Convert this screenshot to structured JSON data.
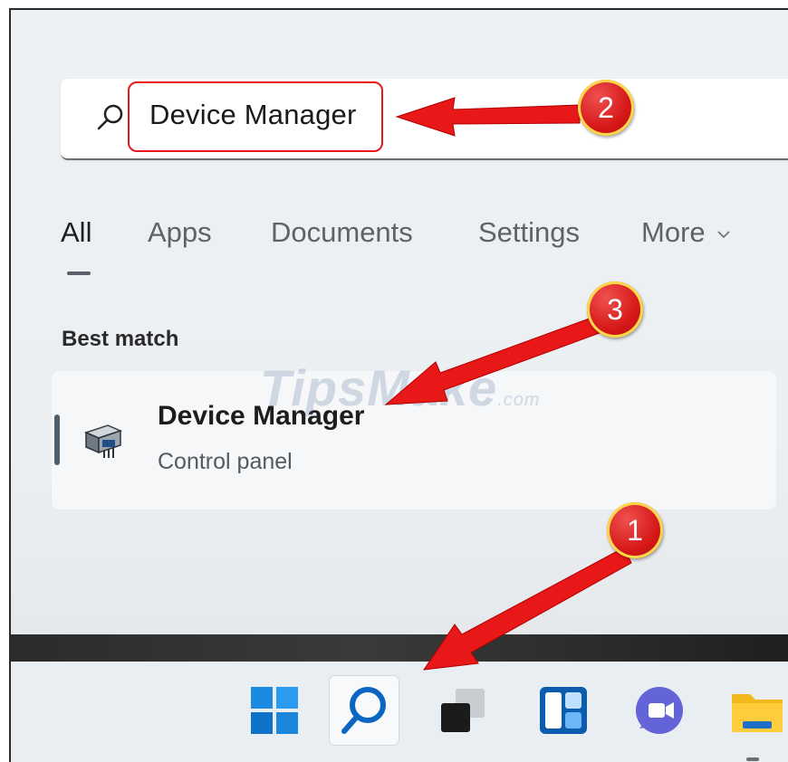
{
  "search": {
    "query": "Device Manager"
  },
  "tabs": [
    {
      "label": "All"
    },
    {
      "label": "Apps"
    },
    {
      "label": "Documents"
    },
    {
      "label": "Settings"
    },
    {
      "label": "More"
    }
  ],
  "best_match": {
    "heading": "Best match",
    "title": "Device Manager",
    "subtitle": "Control panel",
    "icon": "device-manager-icon"
  },
  "watermark": {
    "text": "TipsMake",
    "domain": ".com"
  },
  "annotations": [
    {
      "number": "1",
      "target": "taskbar search button"
    },
    {
      "number": "2",
      "target": "search box"
    },
    {
      "number": "3",
      "target": "Device Manager result"
    }
  ],
  "taskbar": {
    "items": [
      {
        "icon": "windows-start-icon"
      },
      {
        "icon": "search-icon"
      },
      {
        "icon": "task-view-icon"
      },
      {
        "icon": "widgets-icon"
      },
      {
        "icon": "teams-chat-icon"
      },
      {
        "icon": "file-explorer-icon"
      }
    ]
  },
  "colors": {
    "annotation_red": "#e81818",
    "accent_blue": "#0a66c2"
  }
}
